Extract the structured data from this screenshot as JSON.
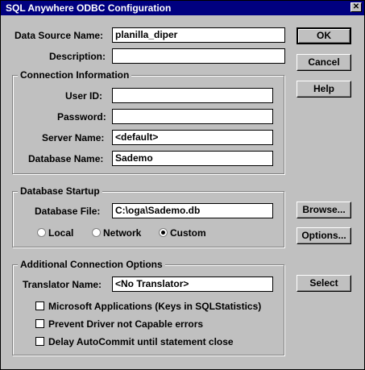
{
  "window": {
    "title": "SQL Anywhere ODBC Configuration",
    "close_glyph": "✕"
  },
  "fields": {
    "data_source_name": {
      "label": "Data Source Name:",
      "value": "planilla_diper"
    },
    "description": {
      "label": "Description:",
      "value": ""
    }
  },
  "connection": {
    "title": "Connection Information",
    "user_id": {
      "label": "User ID:",
      "value": ""
    },
    "password": {
      "label": "Password:",
      "value": ""
    },
    "server_name": {
      "label": "Server Name:",
      "value": "<default>"
    },
    "database_name": {
      "label": "Database Name:",
      "value": "Sademo"
    }
  },
  "startup": {
    "title": "Database Startup",
    "database_file": {
      "label": "Database File:",
      "value": "C:\\oga\\Sademo.db"
    },
    "radios": [
      {
        "label": "Local",
        "selected": false
      },
      {
        "label": "Network",
        "selected": false
      },
      {
        "label": "Custom",
        "selected": true
      }
    ]
  },
  "additional": {
    "title": "Additional Connection Options",
    "translator": {
      "label": "Translator Name:",
      "value": "<No Translator>"
    },
    "checks": [
      {
        "label": "Microsoft Applications (Keys in SQLStatistics)",
        "checked": false
      },
      {
        "label": "Prevent Driver not Capable errors",
        "checked": false
      },
      {
        "label": "Delay AutoCommit until statement close",
        "checked": false
      }
    ]
  },
  "buttons": {
    "ok": "OK",
    "cancel": "Cancel",
    "help": "Help",
    "browse": "Browse...",
    "options": "Options...",
    "select": "Select"
  }
}
